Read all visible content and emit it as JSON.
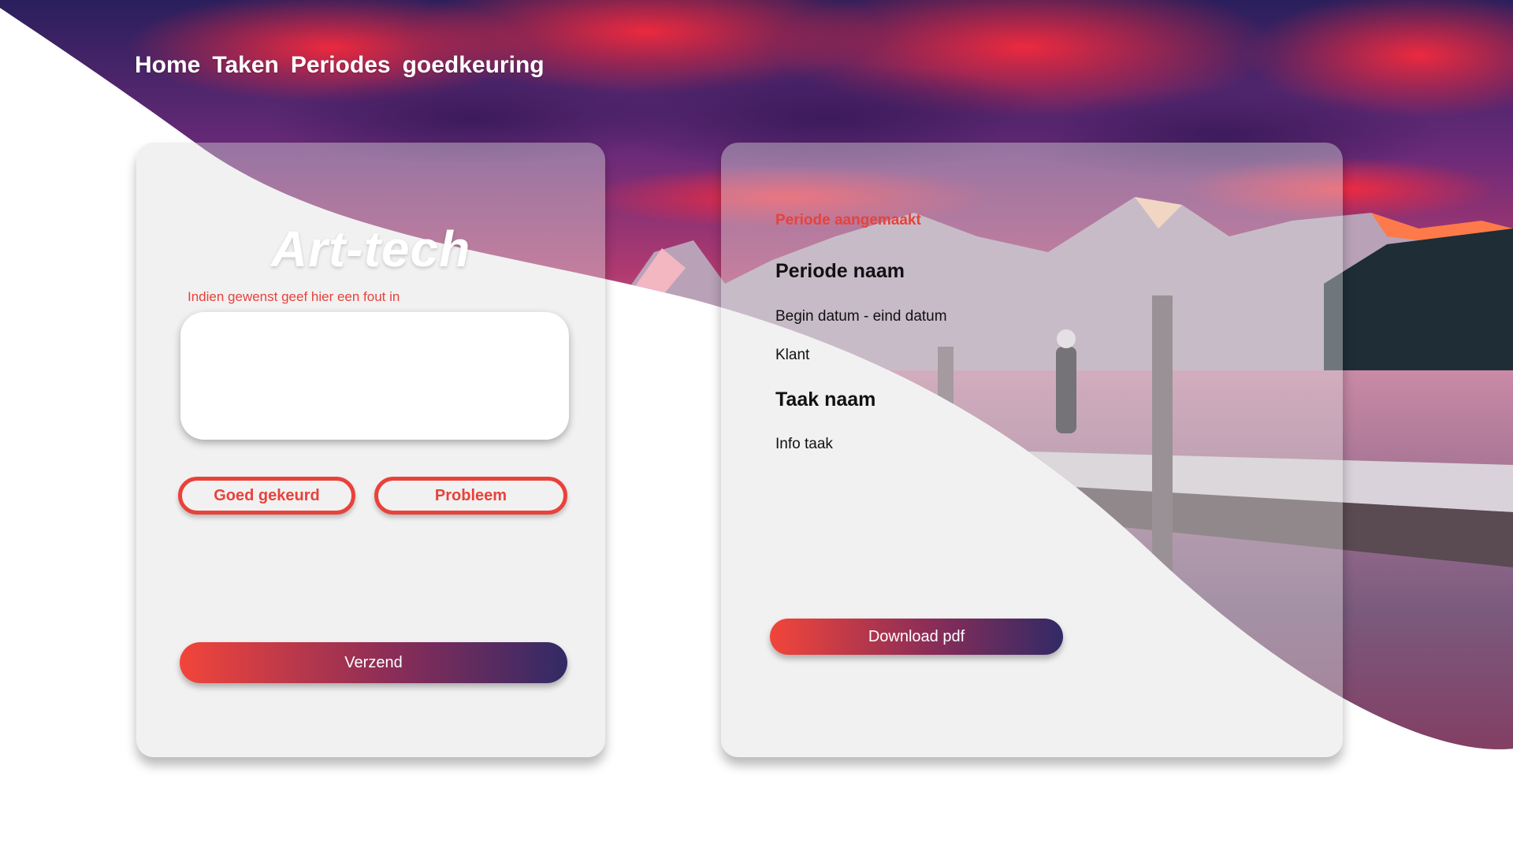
{
  "nav": {
    "home": "Home",
    "tasks": "Taken",
    "periods": "Periodes",
    "approval": "goedkeuring"
  },
  "left_card": {
    "brand": "Art-tech",
    "hint": "Indien gewenst geef hier een fout in",
    "remark_value": "",
    "approved_label": "Goed gekeurd",
    "problem_label": "Probleem",
    "send_label": "Verzend"
  },
  "right_card": {
    "status": "Periode aangemaakt",
    "period_name": "Periode naam",
    "dates": "Begin datum - eind datum",
    "client": "Klant",
    "task_name": "Taak naam",
    "task_info": "Info taak",
    "download_label": "Download pdf"
  },
  "colors": {
    "accent": "#e8423b",
    "gradient_start": "#f2453a",
    "gradient_end": "#322a66",
    "card_glass": "#dddddd"
  }
}
